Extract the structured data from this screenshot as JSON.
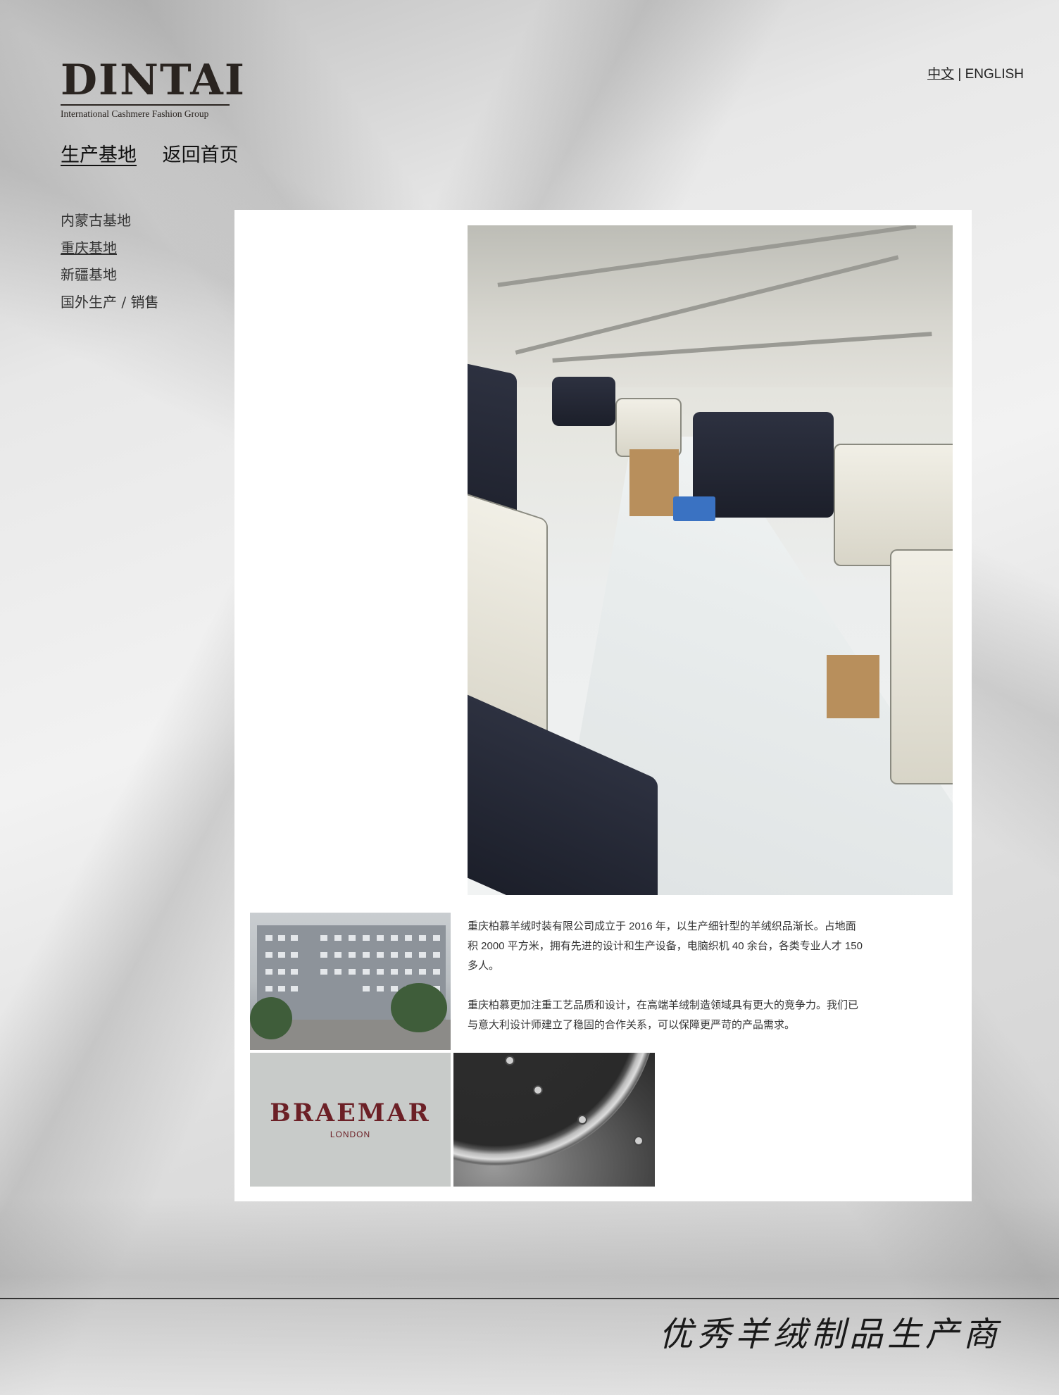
{
  "brand": {
    "logo_text": "DINTAI",
    "tagline": "International Cashmere Fashion Group"
  },
  "language": {
    "zh": "中文",
    "separator": "|",
    "en": "ENGLISH"
  },
  "topnav": {
    "production_base": "生产基地",
    "home": "返回首页"
  },
  "sidenav": {
    "items": [
      {
        "label": "内蒙古基地"
      },
      {
        "label": "重庆基地"
      },
      {
        "label": "新疆基地"
      },
      {
        "label": "国外生产 / 销售"
      }
    ]
  },
  "content": {
    "paragraphs": [
      "重庆柏慕羊绒时装有限公司成立于 2016 年，以生产细针型的羊绒织品渐长。占地面积 2000 平方米，拥有先进的设计和生产设备，电脑织机 40 余台，各类专业人才 150 多人。",
      "重庆柏慕更加注重工艺品质和设计，在高端羊绒制造领域具有更大的竞争力。我们已与意大利设计师建立了稳固的合作关系，可以保障更严苛的产品需求。"
    ],
    "braemar": {
      "name": "BRAEMAR",
      "sub": "LONDON"
    }
  },
  "footer": {
    "slogan": "优秀羊绒制品生产商"
  }
}
